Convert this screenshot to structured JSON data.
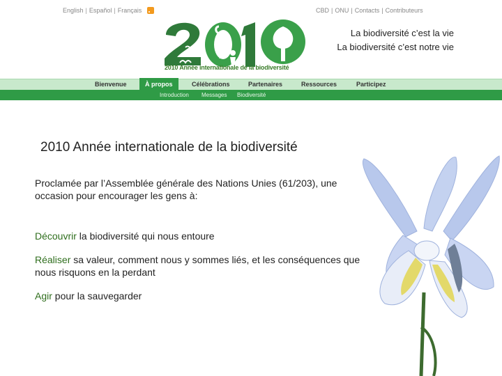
{
  "lang_bar": {
    "items": [
      "English",
      "Español",
      "Français"
    ]
  },
  "top_links": [
    "CBD",
    "ONU",
    "Contacts",
    "Contributeurs"
  ],
  "logo": {
    "text": "2010",
    "caption": "2010 Année internationale de la biodiversité"
  },
  "tagline": {
    "line1": "La biodiversité c’est la vie",
    "line2": "La biodiversité c’est notre vie"
  },
  "nav": {
    "items": [
      "Bienvenue",
      "À propos",
      "Célébrations",
      "Partenaires",
      "Ressources",
      "Participez"
    ],
    "active": "À propos"
  },
  "subnav": {
    "items": [
      "Introduction",
      "Messages",
      "Biodiversité"
    ]
  },
  "page": {
    "title": "2010 Année internationale de la biodiversité",
    "intro": "Proclamée par l’Assemblée générale des Nations Unies (61/203), une occasion pour encourager les gens à:",
    "points": [
      {
        "keyword": "Découvrir",
        "rest": " la biodiversité qui nous entoure"
      },
      {
        "keyword": "Réaliser",
        "rest": " sa valeur, comment nous y sommes liés, et les conséquences que nous risquons en la perdant"
      },
      {
        "keyword": "Agir",
        "rest": " pour la sauvegarder"
      }
    ]
  },
  "colors": {
    "brand_green": "#2f9b46",
    "nav_bg": "#c8e9cc",
    "keyword": "#2f6e1d",
    "iris_petal": "#b8c8ec",
    "iris_yellow": "#e3d96a"
  },
  "image": {
    "icon": "iris-flower-image"
  }
}
